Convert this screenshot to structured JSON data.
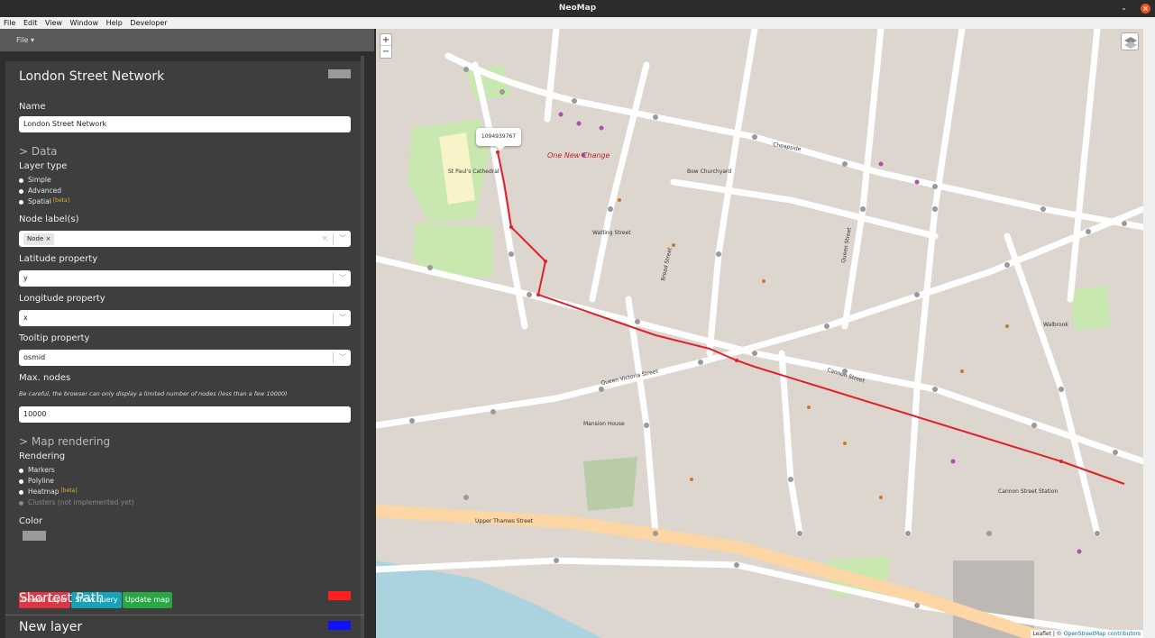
{
  "window": {
    "title": "NeoMap"
  },
  "menu": {
    "items": [
      "File",
      "Edit",
      "View",
      "Window",
      "Help",
      "Developer"
    ]
  },
  "sidebar": {
    "file_menu": "File",
    "layers": [
      {
        "name": "London Street Network",
        "color": "#9a9a9a"
      },
      {
        "name": "Shortest Path",
        "color": "#ff2020"
      },
      {
        "name": "New layer",
        "color": "#1010ff"
      }
    ],
    "form": {
      "name_label": "Name",
      "name_value": "London Street Network",
      "data_section": "> Data",
      "layer_type_label": "Layer type",
      "layer_types": [
        "Simple",
        "Advanced",
        "Spatial"
      ],
      "beta": "[beta]",
      "node_labels_label": "Node label(s)",
      "node_label_chip": "Node",
      "chip_remove": "×",
      "clear_icon": "×",
      "latitude_label": "Latitude property",
      "latitude_value": "y",
      "longitude_label": "Longitude property",
      "longitude_value": "x",
      "tooltip_label": "Tooltip property",
      "tooltip_value": "osmid",
      "max_nodes_label": "Max. nodes",
      "max_nodes_hint": "Be careful, the browser can only display a limited number of nodes (less than a few 10000)",
      "max_nodes_value": "10000",
      "map_rendering_section": "> Map rendering",
      "rendering_label": "Rendering",
      "rendering_options": [
        "Markers",
        "Polyline",
        "Heatmap",
        "Clusters (not implemented yet)"
      ],
      "color_label": "Color",
      "buttons": {
        "delete": "Delete Layer",
        "show_query": "Show query",
        "update_map": "Update map"
      }
    },
    "colors": {
      "delete": "#dc3545",
      "show_query": "#17a2b8",
      "update_map": "#28a745"
    }
  },
  "map": {
    "zoom_in": "+",
    "zoom_out": "−",
    "tooltip_text": "1094939767",
    "attribution_prefix": "Leaflet | © ",
    "attribution_link": "OpenStreetMap contributors",
    "labels": [
      "One New Change",
      "St Paul's Cathedral",
      "Watling Street",
      "Queen Victoria Street",
      "Cannon Street",
      "Bow Churchyard",
      "Upper Thames Street",
      "Mansion House",
      "Cheapside",
      "Queen Street",
      "Cannon Street Station",
      "Walbrook",
      "Bread Street"
    ]
  }
}
